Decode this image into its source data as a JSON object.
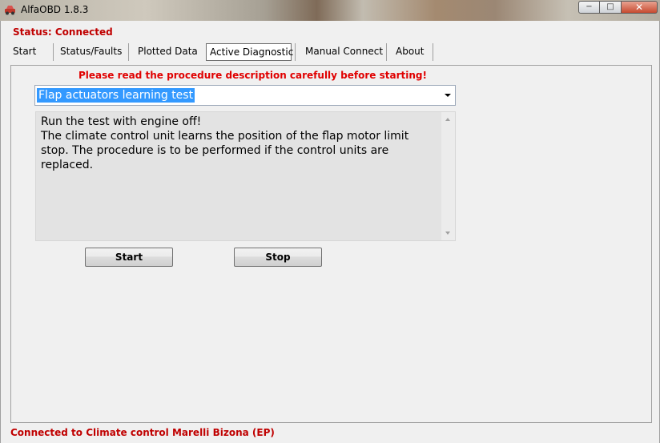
{
  "window": {
    "title": "AlfaOBD 1.8.3",
    "controls": {
      "minimize": "−",
      "maximize": "□",
      "close": "✕"
    }
  },
  "status": {
    "text": "Status: Connected",
    "color": "#c00000"
  },
  "tabs": [
    {
      "label": "Start"
    },
    {
      "label": "Status/Faults"
    },
    {
      "label": "Plotted Data"
    },
    {
      "label": "Active Diagnostic",
      "active": true
    },
    {
      "label": "Manual Connect"
    },
    {
      "label": "About"
    }
  ],
  "diagnostic": {
    "warning": "Please read the procedure description carefully before starting!",
    "procedure_select": {
      "selected": "Flap actuators learning test"
    },
    "description": "Run the test with engine off!\nThe climate control unit learns the position of the flap motor limit stop. The procedure is to be performed if the control units are replaced.",
    "start_label": "Start",
    "stop_label": "Stop"
  },
  "footer": {
    "text": "Connected to Climate control Marelli Bizona (EP)"
  },
  "colors": {
    "status_red": "#c00000",
    "warning_red": "#e00000",
    "selection_blue": "#3399ff"
  },
  "icons": {
    "app": "car-icon",
    "dropdown": "chevron-down-icon"
  }
}
